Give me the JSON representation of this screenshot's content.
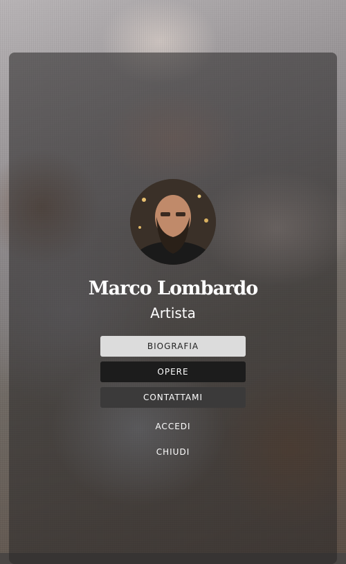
{
  "profile": {
    "name": "Marco Lombardo",
    "role": "Artista"
  },
  "menu": {
    "biografia": "BIOGRAFIA",
    "opere": "OPERE",
    "contattami": "CONTATTAMI",
    "accedi": "ACCEDI",
    "chiudi": "CHIUDI"
  },
  "colors": {
    "overlay": "#282626",
    "button_light": "#dcdcdc",
    "button_dark": "#1c1c1c",
    "button_gray": "#3b3a3a",
    "text": "#ffffff"
  }
}
